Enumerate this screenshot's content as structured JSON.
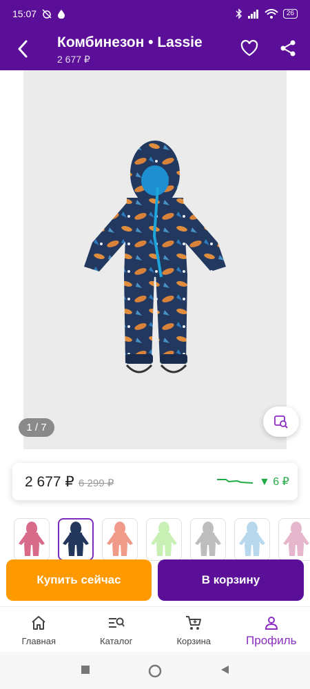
{
  "status_bar": {
    "time": "15:07",
    "battery": "26"
  },
  "header": {
    "title": "Комбинезон • Lassie",
    "price": "2 677 ₽"
  },
  "gallery": {
    "counter": "1 / 7",
    "thumbnail_colors": [
      "#d86a8a",
      "#23375c",
      "#f09a8a",
      "#c8f0b4",
      "#bdbdbd",
      "#b8d8ee",
      "#e6b6cc"
    ],
    "selected_thumbnail": 1
  },
  "price_card": {
    "current": "2 677 ₽",
    "old": "6 299 ₽",
    "drop": "▼ 6 ₽"
  },
  "actions": {
    "buy_now": "Купить сейчас",
    "add_to_cart": "В корзину"
  },
  "bottom_nav": {
    "items": [
      {
        "label": "Главная",
        "icon": "home-icon"
      },
      {
        "label": "Каталог",
        "icon": "catalog-search-icon"
      },
      {
        "label": "Корзина",
        "icon": "cart-icon"
      },
      {
        "label": "Профиль",
        "icon": "profile-icon"
      }
    ],
    "active_index": 3
  },
  "colors": {
    "brand_purple": "#5b0f99",
    "accent_orange": "#ff9900",
    "price_drop_green": "#22aa44"
  }
}
